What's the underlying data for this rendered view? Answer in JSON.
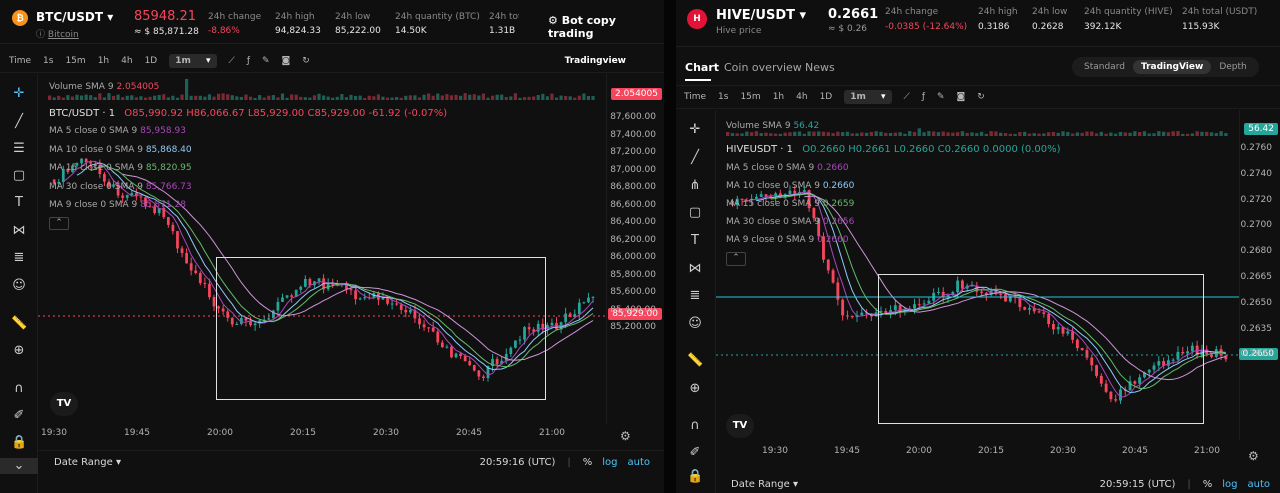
{
  "left": {
    "pair": "BTC/USDT",
    "coin_letter": "₿",
    "coin_color": "#f7931a",
    "coin_name": "Bitcoin",
    "price": "85948.21",
    "price_usd": "≈ $ 85,871.28",
    "stats": [
      {
        "label": "24h change",
        "value": "-8.86%",
        "neg": true
      },
      {
        "label": "24h high",
        "value": "94,824.33"
      },
      {
        "label": "24h low",
        "value": "85,222.00"
      },
      {
        "label": "24h quantity (BTC)",
        "value": "14.50K"
      },
      {
        "label": "24h total",
        "value": "1.31B"
      }
    ],
    "copy_btn": "Bot copy trading",
    "toolbar": [
      "Time",
      "1s",
      "15m",
      "1h",
      "4h",
      "1D",
      "1m"
    ],
    "active_tf": "1m",
    "tv_label": "Tradingview",
    "volume_legend": "Volume SMA 9",
    "volume_value": "2.054005",
    "symbol_line": "BTC/USDT · 1",
    "ohlc": "O85,990.92 H86,066.67 L85,929.00 C85,929.00 -61.92 (-0.07%)",
    "ma": [
      {
        "label": "MA 5 close 0 SMA 9",
        "value": "85,958.93",
        "color": "#ab47bc"
      },
      {
        "label": "MA 10 close 0 SMA 9",
        "value": "85,868.40",
        "color": "#90caf9"
      },
      {
        "label": "MA 15 close 0 SMA 9",
        "value": "85,820.95",
        "color": "#66bb6a"
      },
      {
        "label": "MA 30 close 0 SMA 9",
        "value": "85,766.73",
        "color": "#ab47bc"
      },
      {
        "label": "MA 9 close 0 SMA 9",
        "value": "85,871.28",
        "color": "#ab47bc"
      }
    ],
    "yticks": [
      "87,600.00",
      "87,400.00",
      "87,200.00",
      "87,000.00",
      "86,800.00",
      "86,600.00",
      "86,400.00",
      "86,200.00",
      "86,000.00",
      "85,800.00",
      "85,600.00",
      "85,400.00",
      "85,200.00"
    ],
    "vol_tag": "2.054005",
    "price_tag": "85,929.00",
    "xticks": [
      "19:30",
      "19:45",
      "20:00",
      "20:15",
      "20:30",
      "20:45",
      "21:00"
    ],
    "date_range": "Date Range",
    "time": "20:59:16 (UTC)",
    "pct": "%",
    "log": "log",
    "auto": "auto"
  },
  "right": {
    "pair": "HIVE/USDT",
    "coin_letter": "H",
    "coin_color": "#e31337",
    "coin_name": "Hive price",
    "price": "0.2661",
    "price_usd": "≈ $ 0.26",
    "stats": [
      {
        "label": "24h change",
        "value": "-0.0385 (-12.64%)",
        "neg": true
      },
      {
        "label": "24h high",
        "value": "0.3186"
      },
      {
        "label": "24h low",
        "value": "0.2628"
      },
      {
        "label": "24h quantity (HIVE)",
        "value": "392.12K"
      },
      {
        "label": "24h total (USDT)",
        "value": "115.93K"
      }
    ],
    "tabs": [
      "Chart",
      "Coin overview",
      "News"
    ],
    "views": [
      "Standard",
      "TradingView",
      "Depth"
    ],
    "toolbar": [
      "Time",
      "1s",
      "15m",
      "1h",
      "4h",
      "1D",
      "1m"
    ],
    "active_tf": "1m",
    "volume_legend": "Volume SMA 9",
    "volume_value": "56.42",
    "symbol_line": "HIVEUSDT · 1",
    "ohlc": "O0.2660 H0.2661 L0.2660 C0.2660 0.0000 (0.00%)",
    "ma": [
      {
        "label": "MA 5 close 0 SMA 9",
        "value": "0.2660",
        "color": "#ab47bc"
      },
      {
        "label": "MA 10 close 0 SMA 9",
        "value": "0.2660",
        "color": "#90caf9"
      },
      {
        "label": "MA 15 close 0 SMA 9",
        "value": "0.2659",
        "color": "#66bb6a"
      },
      {
        "label": "MA 30 close 0 SMA 9",
        "value": "0.2656",
        "color": "#ab47bc"
      },
      {
        "label": "MA 9 close 0 SMA 9",
        "value": "0.2660",
        "color": "#ab47bc"
      }
    ],
    "yticks": [
      "0.2760",
      "0.2740",
      "0.2720",
      "0.2700",
      "0.2680",
      "0.2665",
      "0.2650",
      "0.2635",
      "0.2623"
    ],
    "vol_tag": "56.42",
    "price_tag": "0.2660",
    "xticks": [
      "19:30",
      "19:45",
      "20:00",
      "20:15",
      "20:30",
      "20:45",
      "21:00"
    ],
    "date_range": "Date Range",
    "time": "20:59:15 (UTC)",
    "pct": "%",
    "log": "log",
    "auto": "auto"
  }
}
